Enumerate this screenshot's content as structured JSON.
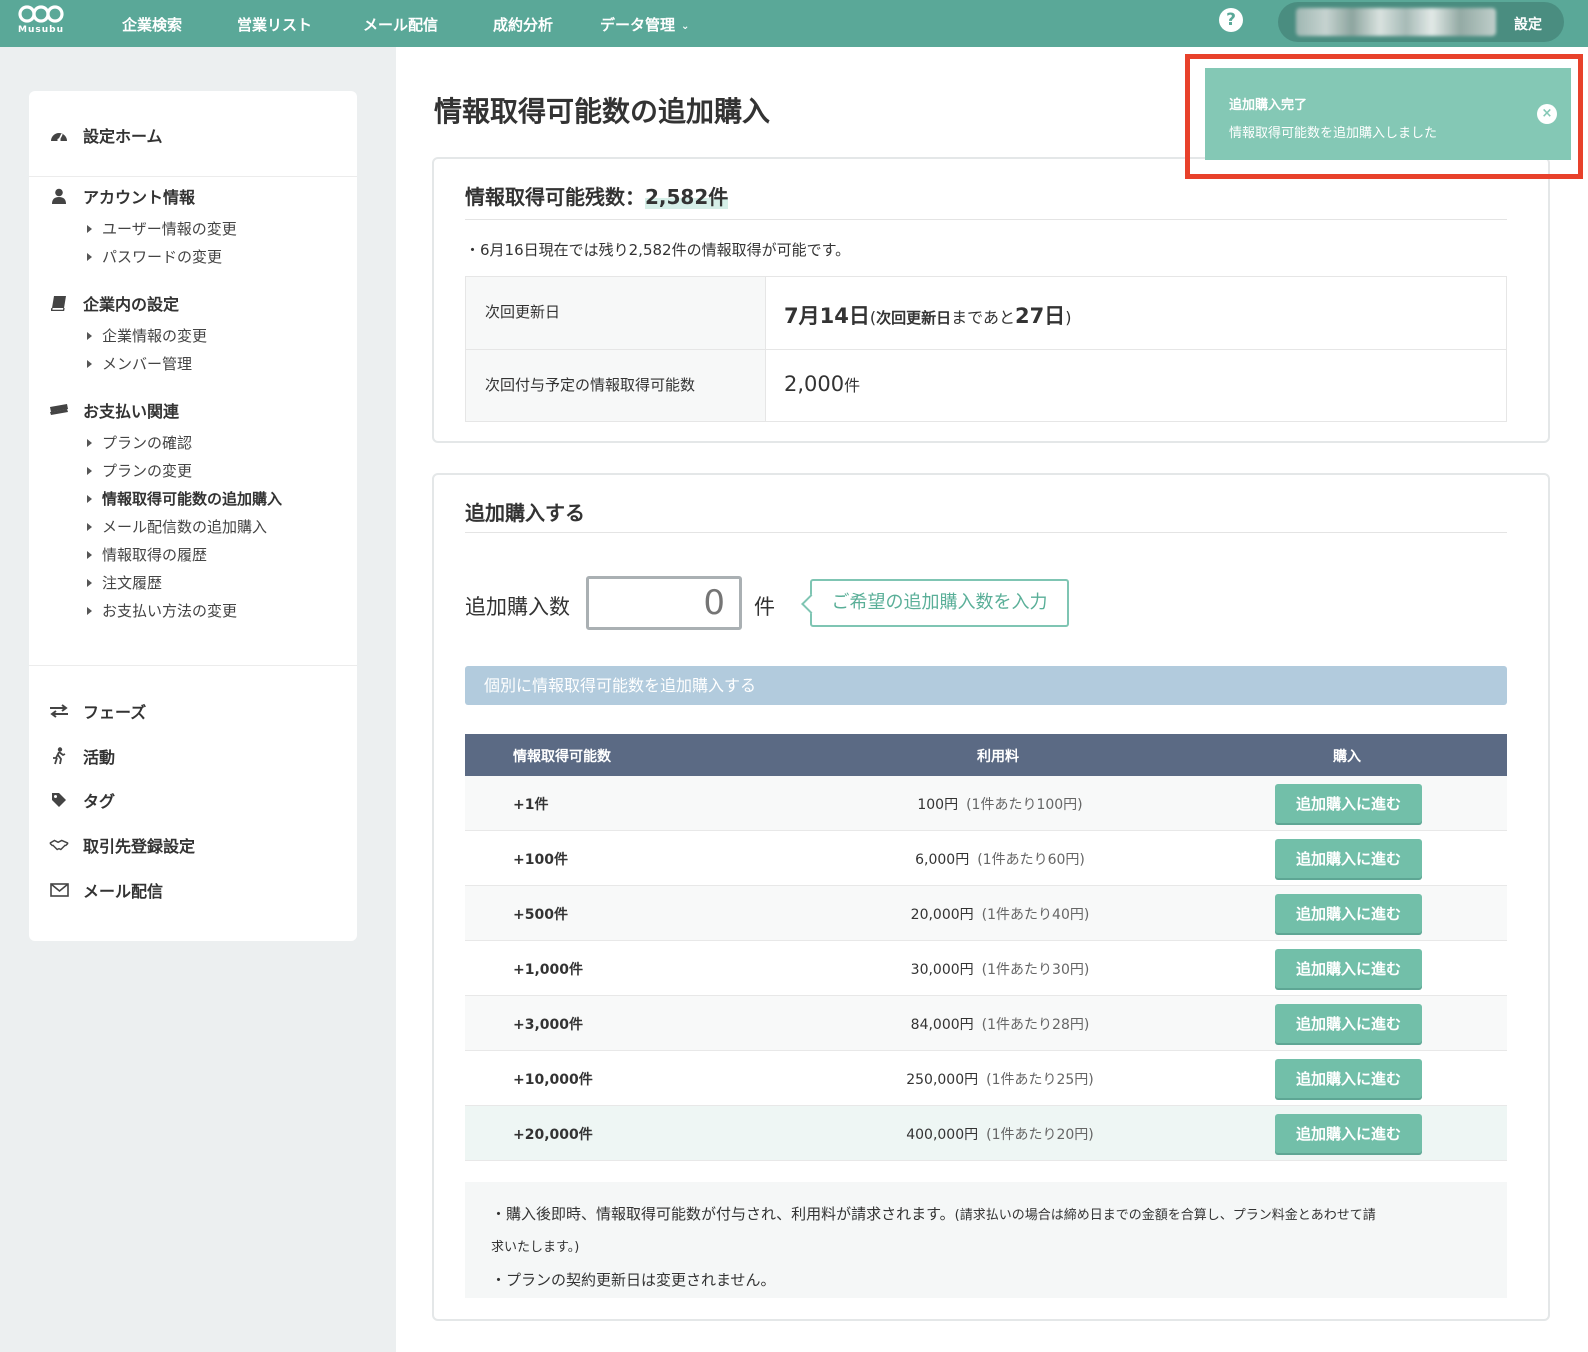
{
  "header": {
    "logo_text": "Musubu",
    "nav": [
      "企業検索",
      "営業リスト",
      "メール配信",
      "成約分析",
      "データ管理"
    ],
    "help_label": "?",
    "settings_label": "設定"
  },
  "sidebar": {
    "home": "設定ホーム",
    "account": {
      "title": "アカウント情報",
      "items": [
        "ユーザー情報の変更",
        "パスワードの変更"
      ]
    },
    "company": {
      "title": "企業内の設定",
      "items": [
        "企業情報の変更",
        "メンバー管理"
      ]
    },
    "payment": {
      "title": "お支払い関連",
      "items": [
        "プランの確認",
        "プランの変更",
        "情報取得可能数の追加購入",
        "メール配信数の追加購入",
        "情報取得の履歴",
        "注文履歴",
        "お支払い方法の変更"
      ]
    },
    "bottom": [
      "フェーズ",
      "活動",
      "タグ",
      "取引先登録設定",
      "メール配信"
    ]
  },
  "page": {
    "title": "情報取得可能数の追加購入"
  },
  "remaining": {
    "title_prefix": "情報取得可能残数：",
    "count": "2,582件",
    "note": "・6月16日現在では残り2,582件の情報取得が可能です。",
    "next_update_label": "次回更新日",
    "next_update_date": "7月14日",
    "next_update_paren_open": "(",
    "next_update_bold": "次回更新日",
    "next_update_mid": "まであと",
    "next_update_days": "27日",
    "next_update_paren_close": ")",
    "next_grant_label": "次回付与予定の情報取得可能数",
    "next_grant_value": "2,000",
    "next_grant_unit": "件"
  },
  "purchase": {
    "title": "追加購入する",
    "qty_label": "追加購入数",
    "qty_placeholder": "0",
    "qty_unit": "件",
    "hint": "ご希望の追加購入数を入力",
    "section_bar": "個別に情報取得可能数を追加購入する",
    "table": {
      "headers": [
        "情報取得可能数",
        "利用料",
        "購入"
      ],
      "rows": [
        {
          "qty": "+1件",
          "price": "100円",
          "unit": "(1件あたり100円)",
          "button": "追加購入に進む"
        },
        {
          "qty": "+100件",
          "price": "6,000円",
          "unit": "(1件あたり60円)",
          "button": "追加購入に進む"
        },
        {
          "qty": "+500件",
          "price": "20,000円",
          "unit": "(1件あたり40円)",
          "button": "追加購入に進む"
        },
        {
          "qty": "+1,000件",
          "price": "30,000円",
          "unit": "(1件あたり30円)",
          "button": "追加購入に進む"
        },
        {
          "qty": "+3,000件",
          "price": "84,000円",
          "unit": "(1件あたり28円)",
          "button": "追加購入に進む"
        },
        {
          "qty": "+10,000件",
          "price": "250,000円",
          "unit": "(1件あたり25円)",
          "button": "追加購入に進む"
        },
        {
          "qty": "+20,000件",
          "price": "400,000円",
          "unit": "(1件あたり20円)",
          "button": "追加購入に進む"
        }
      ]
    },
    "notes": {
      "line1": "・購入後即時、情報取得可能数が付与され、利用料が請求されます。",
      "line1_small": "(請求払いの場合は締め日までの金額を合算し、プラン料金とあわせて請",
      "line2": "求いたします。)",
      "line3": "・プランの契約更新日は変更されません。"
    }
  },
  "toast": {
    "title": "追加購入完了",
    "message": "情報取得可能数を追加購入しました",
    "close_label": "×"
  },
  "colors": {
    "brand": "#5aa898",
    "button": "#72bfa9",
    "table_head": "#5b6a84",
    "section_bar": "#b2cbdd",
    "highlight_frame": "#e8412b"
  }
}
